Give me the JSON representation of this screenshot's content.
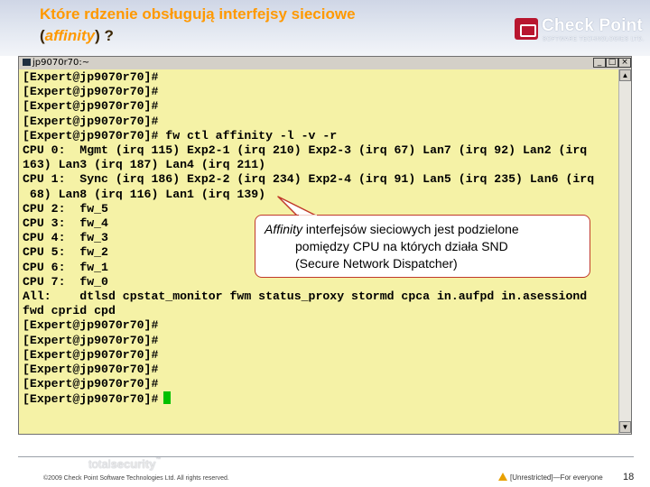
{
  "slide": {
    "title_line1": "Które rdzenie obsługują interfejsy sieciowe",
    "title_line2_open": "(",
    "title_line2_italic": "affinity",
    "title_line2_close": ") ?"
  },
  "logo": {
    "name": "Check Point",
    "tagline": "SOFTWARE TECHNOLOGIES LTD."
  },
  "window": {
    "title": "jp9070r70:~",
    "minimize": "_",
    "maximize": "□",
    "close": "×"
  },
  "terminal": {
    "lines": [
      "[Expert@jp9070r70]#",
      "[Expert@jp9070r70]#",
      "[Expert@jp9070r70]#",
      "[Expert@jp9070r70]#",
      "[Expert@jp9070r70]# fw ctl affinity -l -v -r",
      "CPU 0:  Mgmt (irq 115) Exp2-1 (irq 210) Exp2-3 (irq 67) Lan7 (irq 92) Lan2 (irq",
      "163) Lan3 (irq 187) Lan4 (irq 211)",
      "CPU 1:  Sync (irq 186) Exp2-2 (irq 234) Exp2-4 (irq 91) Lan5 (irq 235) Lan6 (irq",
      " 68) Lan8 (irq 116) Lan1 (irq 139)",
      "CPU 2:  fw_5",
      "CPU 3:  fw_4",
      "CPU 4:  fw_3",
      "CPU 5:  fw_2",
      "CPU 6:  fw_1",
      "CPU 7:  fw_0",
      "All:    dtlsd cpstat_monitor fwm status_proxy stormd cpca in.aufpd in.asessiond",
      "fwd cprid cpd",
      "[Expert@jp9070r70]#",
      "[Expert@jp9070r70]#",
      "[Expert@jp9070r70]#",
      "[Expert@jp9070r70]#",
      "[Expert@jp9070r70]#",
      "[Expert@jp9070r70]#"
    ]
  },
  "callout": {
    "italic_word": "Affinity",
    "line1_rest": " interfejsów sieciowych jest podzielone",
    "line2": "pomiędzy CPU na których działa SND",
    "line3": "(Secure Network Dispatcher)"
  },
  "footer": {
    "brand_light": "total",
    "brand_bold": "security",
    "brand_tm": "™",
    "copyright": "©2009 Check Point Software Technologies Ltd. All rights reserved.",
    "classification": "[Unrestricted]—For everyone",
    "page_number": "18"
  },
  "colors": {
    "title": "#ff9900",
    "terminal_bg": "#f5f2a6",
    "cursor": "#00c000",
    "callout_border": "#c0392b",
    "logo_badge": "#b8162f"
  },
  "icons": [
    "warning-icon",
    "check-point-logo-icon",
    "terminal-window-icon"
  ]
}
